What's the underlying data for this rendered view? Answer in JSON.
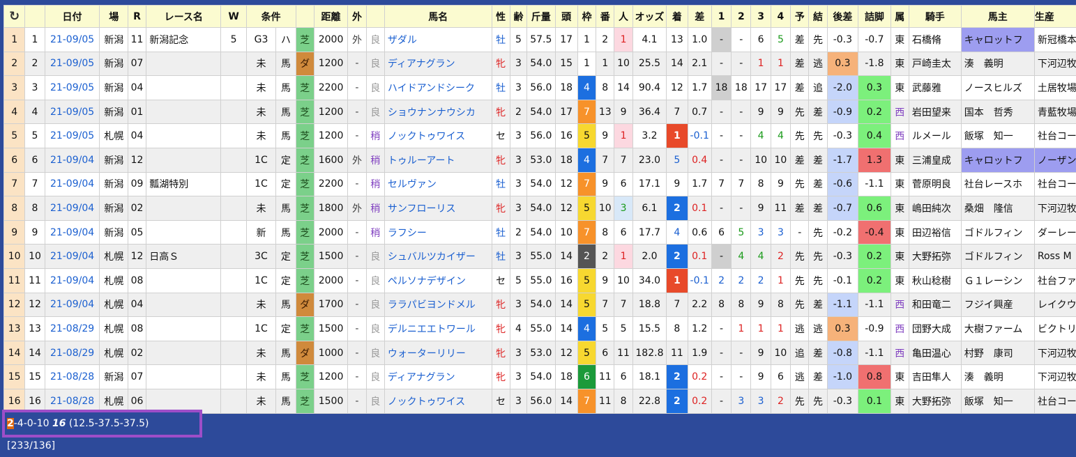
{
  "header": {
    "reload_icon": "refresh-icon",
    "cols": [
      "日付",
      "場",
      "R",
      "レース名",
      "W",
      "条件",
      "",
      "距離",
      "外",
      "",
      "馬名",
      "性",
      "齢",
      "斤量",
      "頭",
      "枠",
      "番",
      "人",
      "オッズ",
      "着",
      "差",
      "1",
      "2",
      "3",
      "4",
      "予",
      "結",
      "後差",
      "詰脚",
      "属",
      "騎手",
      "馬主",
      "生産"
    ]
  },
  "rows": [
    {
      "no": "1",
      "n": "1",
      "date": "21-09/05",
      "place": "新潟",
      "r": "11",
      "race": "新潟記念",
      "w": "5",
      "cls": "G3",
      "cls2": "ハ",
      "track": "芝",
      "dist": "2000",
      "out": "外",
      "cond": "良",
      "horse": "ザダル",
      "sex": "牡",
      "age": "5",
      "wt": "57.5",
      "heads": "17",
      "waku": "1",
      "ban": "2",
      "pop": "1",
      "odds": "4.1",
      "fin": "13",
      "diff": "1.0",
      "c1": "-",
      "c2": "-",
      "c3": "6",
      "c4": "5",
      "yo": "差",
      "ketsu": "先",
      "ago": "-0.3",
      "last": "-0.7",
      "zoku": "東",
      "jockey": "石橋脩",
      "owner": "キャロットフ",
      "breeder": "新冠橋本"
    },
    {
      "no": "2",
      "n": "2",
      "date": "21-09/05",
      "place": "新潟",
      "r": "07",
      "race": "",
      "w": "",
      "cls": "未",
      "cls2": "馬",
      "track": "ダ",
      "dist": "1200",
      "out": "-",
      "cond": "良",
      "horse": "ディアナグラン",
      "sex": "牝",
      "age": "3",
      "wt": "54.0",
      "heads": "15",
      "waku": "1",
      "ban": "1",
      "pop": "10",
      "odds": "25.5",
      "fin": "14",
      "diff": "2.1",
      "c1": "-",
      "c2": "-",
      "c3": "1",
      "c4": "1",
      "yo": "差",
      "ketsu": "逃",
      "ago": "0.3",
      "last": "-1.8",
      "zoku": "東",
      "jockey": "戸崎圭太",
      "owner": "湊　義明",
      "breeder": "下河辺牧"
    },
    {
      "no": "3",
      "n": "3",
      "date": "21-09/05",
      "place": "新潟",
      "r": "04",
      "race": "",
      "w": "",
      "cls": "未",
      "cls2": "馬",
      "track": "芝",
      "dist": "2200",
      "out": "-",
      "cond": "良",
      "horse": "ハイドアンドシーク",
      "sex": "牡",
      "age": "3",
      "wt": "56.0",
      "heads": "18",
      "waku": "4",
      "ban": "8",
      "pop": "14",
      "odds": "90.4",
      "fin": "12",
      "diff": "1.7",
      "c1": "18",
      "c2": "18",
      "c3": "17",
      "c4": "17",
      "yo": "差",
      "ketsu": "追",
      "ago": "-2.0",
      "last": "0.3",
      "zoku": "東",
      "jockey": "武藤雅",
      "owner": "ノースヒルズ",
      "breeder": "土居牧場"
    },
    {
      "no": "4",
      "n": "4",
      "date": "21-09/05",
      "place": "新潟",
      "r": "01",
      "race": "",
      "w": "",
      "cls": "未",
      "cls2": "馬",
      "track": "芝",
      "dist": "1200",
      "out": "-",
      "cond": "良",
      "horse": "ショウナンナウシカ",
      "sex": "牝",
      "age": "2",
      "wt": "54.0",
      "heads": "17",
      "waku": "7",
      "ban": "13",
      "pop": "9",
      "odds": "36.4",
      "fin": "7",
      "diff": "0.7",
      "c1": "-",
      "c2": "-",
      "c3": "9",
      "c4": "9",
      "yo": "先",
      "ketsu": "差",
      "ago": "-0.9",
      "last": "0.2",
      "zoku": "西",
      "jockey": "岩田望来",
      "owner": "国本　哲秀",
      "breeder": "青藍牧場"
    },
    {
      "no": "5",
      "n": "5",
      "date": "21-09/05",
      "place": "札幌",
      "r": "04",
      "race": "",
      "w": "",
      "cls": "未",
      "cls2": "馬",
      "track": "芝",
      "dist": "1200",
      "out": "-",
      "cond": "稍",
      "horse": "ノックトゥワイス",
      "sex": "セ",
      "age": "3",
      "wt": "56.0",
      "heads": "16",
      "waku": "5",
      "ban": "9",
      "pop": "1",
      "odds": "3.2",
      "fin": "1",
      "diff": "-0.1",
      "c1": "-",
      "c2": "-",
      "c3": "4",
      "c4": "4",
      "yo": "先",
      "ketsu": "先",
      "ago": "-0.3",
      "last": "0.4",
      "zoku": "西",
      "jockey": "ルメール",
      "owner": "飯塚　知一",
      "breeder": "社台コー"
    },
    {
      "no": "6",
      "n": "6",
      "date": "21-09/04",
      "place": "新潟",
      "r": "12",
      "race": "",
      "w": "",
      "cls": "1C",
      "cls2": "定",
      "track": "芝",
      "dist": "1600",
      "out": "外",
      "cond": "稍",
      "horse": "トゥルーアート",
      "sex": "牝",
      "age": "3",
      "wt": "53.0",
      "heads": "18",
      "waku": "4",
      "ban": "7",
      "pop": "7",
      "odds": "23.0",
      "fin": "5",
      "diff": "0.4",
      "c1": "-",
      "c2": "-",
      "c3": "10",
      "c4": "10",
      "yo": "差",
      "ketsu": "差",
      "ago": "-1.7",
      "last": "1.3",
      "zoku": "東",
      "jockey": "三浦皇成",
      "owner": "キャロットフ",
      "breeder": "ノーザン"
    },
    {
      "no": "7",
      "n": "7",
      "date": "21-09/04",
      "place": "新潟",
      "r": "09",
      "race": "瓢湖特別",
      "w": "",
      "cls": "1C",
      "cls2": "定",
      "track": "芝",
      "dist": "2200",
      "out": "-",
      "cond": "稍",
      "horse": "セルヴァン",
      "sex": "牡",
      "age": "3",
      "wt": "54.0",
      "heads": "12",
      "waku": "7",
      "ban": "9",
      "pop": "6",
      "odds": "17.1",
      "fin": "9",
      "diff": "1.7",
      "c1": "7",
      "c2": "7",
      "c3": "8",
      "c4": "9",
      "yo": "先",
      "ketsu": "差",
      "ago": "-0.6",
      "last": "-1.1",
      "zoku": "東",
      "jockey": "菅原明良",
      "owner": "社台レースホ",
      "breeder": "社台コー"
    },
    {
      "no": "8",
      "n": "8",
      "date": "21-09/04",
      "place": "新潟",
      "r": "02",
      "race": "",
      "w": "",
      "cls": "未",
      "cls2": "馬",
      "track": "芝",
      "dist": "1800",
      "out": "外",
      "cond": "稍",
      "horse": "サンフローリス",
      "sex": "牝",
      "age": "3",
      "wt": "54.0",
      "heads": "12",
      "waku": "5",
      "ban": "10",
      "pop": "3",
      "odds": "6.1",
      "fin": "2",
      "diff": "0.1",
      "c1": "-",
      "c2": "-",
      "c3": "9",
      "c4": "11",
      "yo": "差",
      "ketsu": "差",
      "ago": "-0.7",
      "last": "0.6",
      "zoku": "東",
      "jockey": "嶋田純次",
      "owner": "桑畑　隆信",
      "breeder": "下河辺牧"
    },
    {
      "no": "9",
      "n": "9",
      "date": "21-09/04",
      "place": "新潟",
      "r": "05",
      "race": "",
      "w": "",
      "cls": "新",
      "cls2": "馬",
      "track": "芝",
      "dist": "2000",
      "out": "-",
      "cond": "稍",
      "horse": "ラフシー",
      "sex": "牡",
      "age": "2",
      "wt": "54.0",
      "heads": "10",
      "waku": "7",
      "ban": "8",
      "pop": "6",
      "odds": "17.7",
      "fin": "4",
      "diff": "0.6",
      "c1": "6",
      "c2": "5",
      "c3": "3",
      "c4": "3",
      "yo": "-",
      "ketsu": "先",
      "ago": "-0.2",
      "last": "-0.4",
      "zoku": "東",
      "jockey": "田辺裕信",
      "owner": "ゴドルフィン",
      "breeder": "ダーレー"
    },
    {
      "no": "10",
      "n": "10",
      "date": "21-09/04",
      "place": "札幌",
      "r": "12",
      "race": "日高Ｓ",
      "w": "",
      "cls": "3C",
      "cls2": "定",
      "track": "芝",
      "dist": "1500",
      "out": "-",
      "cond": "良",
      "horse": "シュバルツカイザー",
      "sex": "牡",
      "age": "3",
      "wt": "55.0",
      "heads": "14",
      "waku": "2",
      "ban": "2",
      "pop": "1",
      "odds": "2.0",
      "fin": "2",
      "diff": "0.1",
      "c1": "-",
      "c2": "4",
      "c3": "4",
      "c4": "2",
      "yo": "先",
      "ketsu": "先",
      "ago": "-0.3",
      "last": "0.2",
      "zoku": "東",
      "jockey": "大野拓弥",
      "owner": "ゴドルフィン",
      "breeder": "Ross M"
    },
    {
      "no": "11",
      "n": "11",
      "date": "21-09/04",
      "place": "札幌",
      "r": "08",
      "race": "",
      "w": "",
      "cls": "1C",
      "cls2": "定",
      "track": "芝",
      "dist": "2000",
      "out": "-",
      "cond": "良",
      "horse": "ペルソナデザイン",
      "sex": "セ",
      "age": "5",
      "wt": "55.0",
      "heads": "16",
      "waku": "5",
      "ban": "9",
      "pop": "10",
      "odds": "34.0",
      "fin": "1",
      "diff": "-0.1",
      "c1": "2",
      "c2": "2",
      "c3": "2",
      "c4": "1",
      "yo": "先",
      "ketsu": "先",
      "ago": "-0.1",
      "last": "0.2",
      "zoku": "東",
      "jockey": "秋山稔樹",
      "owner": "Ｇ１レーシン",
      "breeder": "社台ファ"
    },
    {
      "no": "12",
      "n": "12",
      "date": "21-09/04",
      "place": "札幌",
      "r": "04",
      "race": "",
      "w": "",
      "cls": "未",
      "cls2": "馬",
      "track": "ダ",
      "dist": "1700",
      "out": "-",
      "cond": "良",
      "horse": "ララパビヨンドメル",
      "sex": "牝",
      "age": "3",
      "wt": "54.0",
      "heads": "14",
      "waku": "5",
      "ban": "7",
      "pop": "7",
      "odds": "18.8",
      "fin": "7",
      "diff": "2.2",
      "c1": "8",
      "c2": "8",
      "c3": "9",
      "c4": "8",
      "yo": "先",
      "ketsu": "差",
      "ago": "-1.1",
      "last": "-1.1",
      "zoku": "西",
      "jockey": "和田竜二",
      "owner": "フジイ興産",
      "breeder": "レイクウ"
    },
    {
      "no": "13",
      "n": "13",
      "date": "21-08/29",
      "place": "札幌",
      "r": "08",
      "race": "",
      "w": "",
      "cls": "1C",
      "cls2": "定",
      "track": "芝",
      "dist": "1500",
      "out": "-",
      "cond": "良",
      "horse": "デルニエエトワール",
      "sex": "牝",
      "age": "4",
      "wt": "55.0",
      "heads": "14",
      "waku": "4",
      "ban": "5",
      "pop": "5",
      "odds": "15.5",
      "fin": "8",
      "diff": "1.2",
      "c1": "-",
      "c2": "1",
      "c3": "1",
      "c4": "1",
      "yo": "逃",
      "ketsu": "逃",
      "ago": "0.3",
      "last": "-0.9",
      "zoku": "西",
      "jockey": "団野大成",
      "owner": "大樹ファーム",
      "breeder": "ビクトリ"
    },
    {
      "no": "14",
      "n": "14",
      "date": "21-08/29",
      "place": "札幌",
      "r": "02",
      "race": "",
      "w": "",
      "cls": "未",
      "cls2": "馬",
      "track": "ダ",
      "dist": "1000",
      "out": "-",
      "cond": "良",
      "horse": "ウォーターリリー",
      "sex": "牝",
      "age": "3",
      "wt": "53.0",
      "heads": "12",
      "waku": "5",
      "ban": "6",
      "pop": "11",
      "odds": "182.8",
      "fin": "11",
      "diff": "1.9",
      "c1": "-",
      "c2": "-",
      "c3": "9",
      "c4": "10",
      "yo": "追",
      "ketsu": "差",
      "ago": "-0.8",
      "last": "-1.1",
      "zoku": "西",
      "jockey": "亀田温心",
      "owner": "村野　康司",
      "breeder": "下河辺牧"
    },
    {
      "no": "15",
      "n": "15",
      "date": "21-08/28",
      "place": "新潟",
      "r": "07",
      "race": "",
      "w": "",
      "cls": "未",
      "cls2": "馬",
      "track": "芝",
      "dist": "1200",
      "out": "-",
      "cond": "良",
      "horse": "ディアナグラン",
      "sex": "牝",
      "age": "3",
      "wt": "54.0",
      "heads": "18",
      "waku": "6",
      "ban": "11",
      "pop": "6",
      "odds": "18.1",
      "fin": "2",
      "diff": "0.2",
      "c1": "-",
      "c2": "-",
      "c3": "9",
      "c4": "6",
      "yo": "逃",
      "ketsu": "差",
      "ago": "-1.0",
      "last": "0.8",
      "zoku": "東",
      "jockey": "吉田隼人",
      "owner": "湊　義明",
      "breeder": "下河辺牧"
    },
    {
      "no": "16",
      "n": "16",
      "date": "21-08/28",
      "place": "札幌",
      "r": "06",
      "race": "",
      "w": "",
      "cls": "未",
      "cls2": "馬",
      "track": "芝",
      "dist": "1500",
      "out": "-",
      "cond": "良",
      "horse": "ノックトゥワイス",
      "sex": "セ",
      "age": "3",
      "wt": "56.0",
      "heads": "14",
      "waku": "7",
      "ban": "11",
      "pop": "8",
      "odds": "22.8",
      "fin": "2",
      "diff": "0.2",
      "c1": "-",
      "c2": "3",
      "c3": "3",
      "c4": "2",
      "yo": "先",
      "ketsu": "先",
      "ago": "-0.3",
      "last": "0.1",
      "zoku": "東",
      "jockey": "大野拓弥",
      "owner": "飯塚　知一",
      "breeder": "社台コー"
    }
  ],
  "status": {
    "first": "2",
    "rest": "-4-0-10 ",
    "total": "16",
    "detail": " (12.5-37.5-37.5) [233/136]"
  }
}
